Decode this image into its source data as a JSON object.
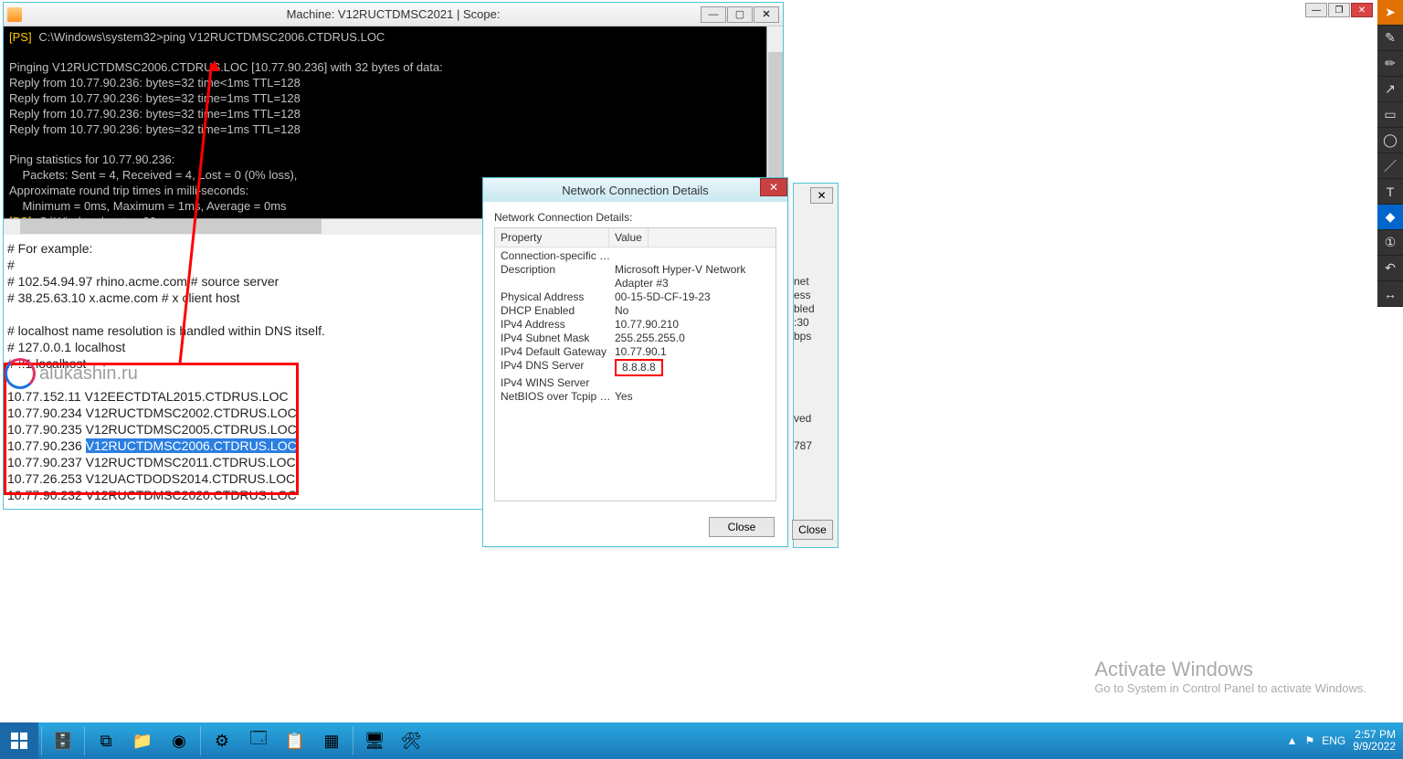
{
  "vm": {
    "title": "Machine: V12RUCTDMSC2021 | Scope:"
  },
  "ps": {
    "prompt1": "[PS]",
    "path": "C:\\Windows\\system32>",
    "cmd": "ping V12RUCTDMSC2006.CTDRUS.LOC",
    "l1": "Pinging V12RUCTDMSC2006.CTDRUS.LOC [10.77.90.236] with 32 bytes of data:",
    "l2": "Reply from 10.77.90.236: bytes=32 time<1ms TTL=128",
    "l3": "Reply from 10.77.90.236: bytes=32 time=1ms TTL=128",
    "l4": "Reply from 10.77.90.236: bytes=32 time=1ms TTL=128",
    "l5": "Reply from 10.77.90.236: bytes=32 time=1ms TTL=128",
    "l6": "Ping statistics for 10.77.90.236:",
    "l7": "    Packets: Sent = 4, Received = 4, Lost = 0 (0% loss),",
    "l8": "Approximate round trip times in milli-seconds:",
    "l9": "    Minimum = 0ms, Maximum = 1ms, Average = 0ms"
  },
  "hosts": {
    "ex": "# For example:",
    "hash": "#",
    "r1": "#      102.54.94.97     rhino.acme.com        # source server",
    "r2": "#       38.25.63.10     x.acme.com            # x client host",
    "note": "# localhost name resolution is handled within DNS itself.",
    "lh1": "#      127.0.0.1       localhost",
    "lh2": "#      ::1             localhost",
    "entries": [
      {
        "ip": "10.77.152.11",
        "host": "V12EECTDTAL2015.CTDRUS.LOC"
      },
      {
        "ip": "10.77.90.234",
        "host": "V12RUCTDMSC2002.CTDRUS.LOC"
      },
      {
        "ip": "10.77.90.235",
        "host": "V12RUCTDMSC2005.CTDRUS.LOC"
      },
      {
        "ip": "10.77.90.236",
        "host": "V12RUCTDMSC2006.CTDRUS.LOC"
      },
      {
        "ip": "10.77.90.237",
        "host": "V12RUCTDMSC2011.CTDRUS.LOC"
      },
      {
        "ip": "10.77.26.253",
        "host": "V12UACTDODS2014.CTDRUS.LOC"
      },
      {
        "ip": "10.77.90.232",
        "host": "V12RUCTDMSC2020.CTDRUS.LOC"
      }
    ]
  },
  "watermark": "alukashin.ru",
  "dlg": {
    "title": "Network Connection Details",
    "label": "Network Connection Details:",
    "head_prop": "Property",
    "head_val": "Value",
    "rows": [
      {
        "p": "Connection-specific DN...",
        "v": ""
      },
      {
        "p": "Description",
        "v": "Microsoft Hyper-V Network Adapter #3"
      },
      {
        "p": "Physical Address",
        "v": "00-15-5D-CF-19-23"
      },
      {
        "p": "DHCP Enabled",
        "v": "No"
      },
      {
        "p": "IPv4 Address",
        "v": "10.77.90.210"
      },
      {
        "p": "IPv4 Subnet Mask",
        "v": "255.255.255.0"
      },
      {
        "p": "IPv4 Default Gateway",
        "v": "10.77.90.1"
      },
      {
        "p": "IPv4 DNS Server",
        "v": "8.8.8.8"
      },
      {
        "p": "IPv4 WINS Server",
        "v": ""
      },
      {
        "p": "NetBIOS over Tcpip En...",
        "v": "Yes"
      }
    ],
    "close": "Close"
  },
  "parent": {
    "bits": "net\ness\nbled\n:30\nbps\n\n\n\n\n\nved\n\n787",
    "close": "Close"
  },
  "activate": {
    "h": "Activate Windows",
    "s": "Go to System in Control Panel to activate Windows."
  },
  "tray": {
    "flag": "▲",
    "lang": "ENG",
    "time": "2:57 PM",
    "date": "9/9/2022"
  }
}
